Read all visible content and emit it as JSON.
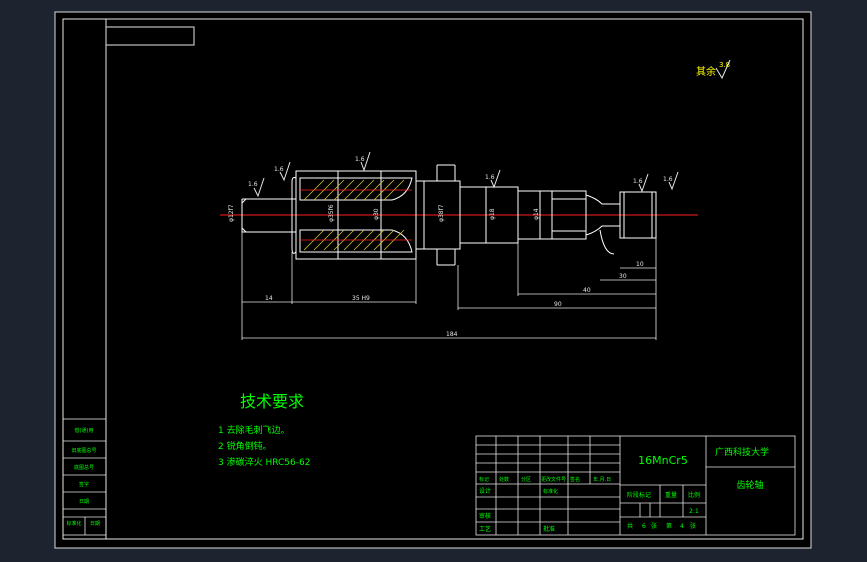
{
  "drawing": {
    "surface_note_label": "其余",
    "general_roughness": "3.8",
    "roughness_values": [
      "1.6",
      "1.6",
      "1.6",
      "1.6",
      "1.6",
      "1.6"
    ],
    "diameters": [
      "φ12f7",
      "φ35f6",
      "φ30",
      "φ38f7",
      "φ18",
      "φ14"
    ],
    "dimensions": {
      "d14": "14",
      "d35": "35 H9",
      "d30": "30",
      "d10": "10",
      "d40": "40",
      "d90": "90",
      "d184": "184"
    }
  },
  "tech_requirements": {
    "title": "技术要求",
    "items": [
      "1 去除毛刺飞边。",
      "2 锐角倒钝。",
      "3 渗碳淬火 HRC56-62"
    ]
  },
  "title_block": {
    "material": "16MnCr5",
    "school": "广西科技大学",
    "part_name": "齿轮轴",
    "scale_value": "2:1",
    "sheet_info": [
      "共",
      "6",
      "张",
      "第",
      "4",
      "张"
    ],
    "col_headers": [
      "标记",
      "处数",
      "分区",
      "更改文件号",
      "签名",
      "年.月.日"
    ],
    "design_label": "设计",
    "standardize_label": "标准化",
    "review_label": "审核",
    "process_label": "工艺",
    "approve_label": "批准",
    "stage_label": "阶段标记",
    "weight_label": "重量",
    "scale_label": "比例"
  },
  "left_strip": {
    "rows": [
      "借(通)用",
      "旧底图总号",
      "底图总号",
      "签字",
      "日期",
      "标准化"
    ],
    "last_extra": "日期"
  }
}
